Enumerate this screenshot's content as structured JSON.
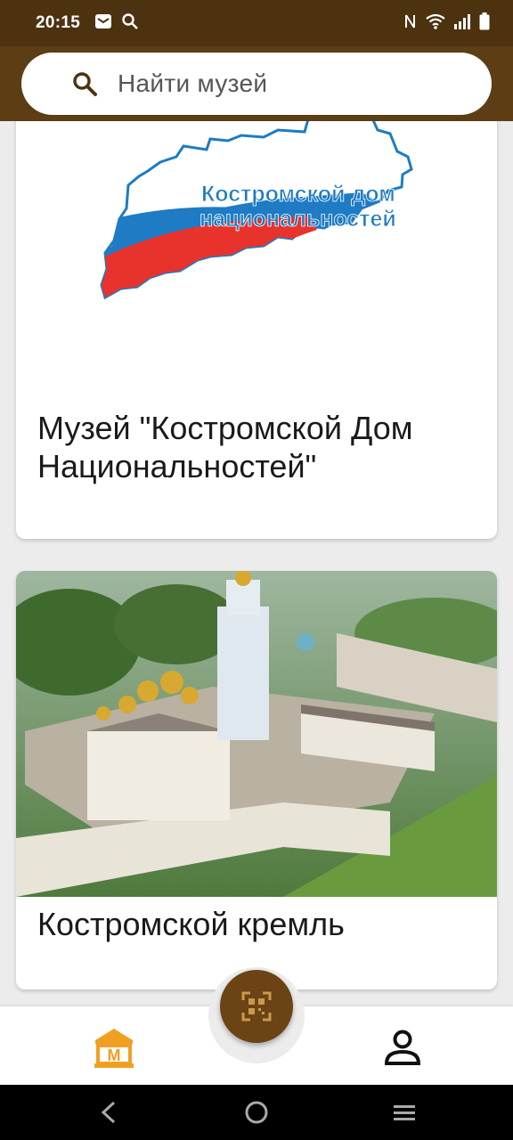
{
  "status_bar": {
    "time": "20:15",
    "left_icons": [
      "mail-icon",
      "search-icon"
    ],
    "right_icons": [
      "nfc-icon",
      "wifi-icon",
      "signal-icon",
      "battery-icon"
    ]
  },
  "search": {
    "placeholder": "Найти музей"
  },
  "museums": [
    {
      "title": "Музей \"Костромской Дом Национальностей\"",
      "logo_text_line1": "Костромской дом",
      "logo_text_line2": "национальностей"
    },
    {
      "title": "Костромской кремль"
    }
  ],
  "bottom_nav": {
    "home_icon": "museum-home-icon",
    "home_letter": "М",
    "scan_icon": "qr-scan-icon",
    "profile_icon": "profile-icon"
  },
  "system_nav": [
    "back-icon",
    "home-circle-icon",
    "recents-icon"
  ],
  "colors": {
    "header": "#5c3d14",
    "status_bar": "#4d3210",
    "accent": "#f0a021",
    "fab": "#6b4314",
    "logo_blue": "#1e7bc4",
    "logo_red": "#e8332c"
  }
}
